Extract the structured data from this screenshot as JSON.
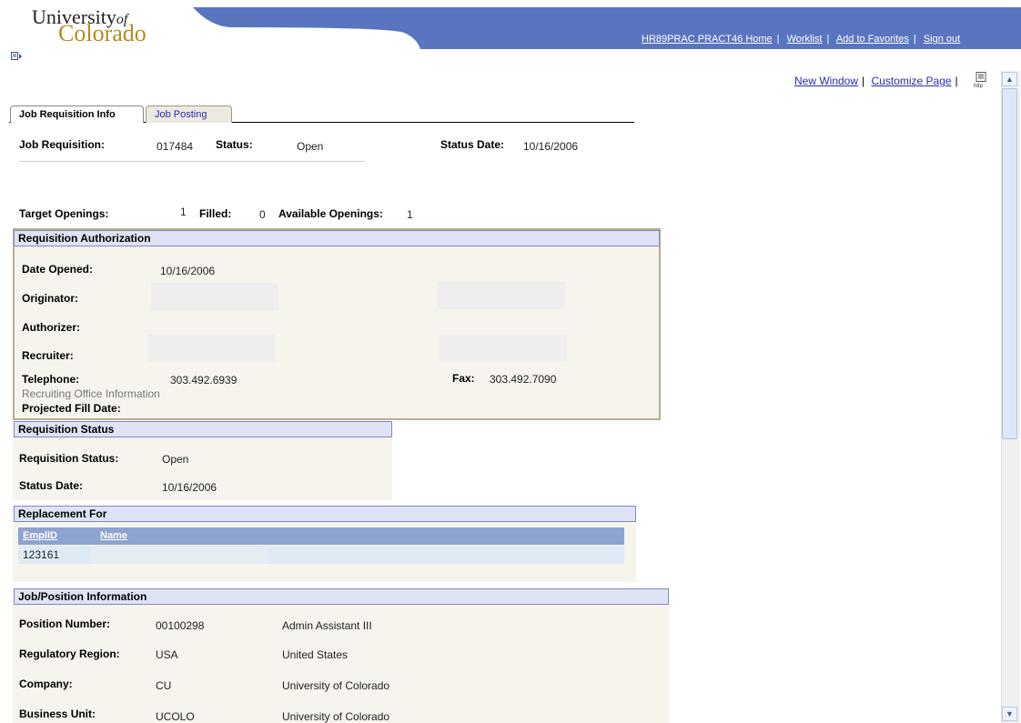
{
  "header": {
    "logo_line1": "University",
    "logo_of": "of",
    "logo_line2": "Colorado",
    "links": [
      "HR89PRAC PRACT46 Home",
      "Worklist",
      "Add to Favorites",
      "Sign out"
    ]
  },
  "page_links": {
    "new_window": "New Window",
    "customize_page": "Customize Page"
  },
  "tabs": {
    "active": "Job Requisition Info",
    "inactive": "Job Posting"
  },
  "summary": {
    "job_requisition_label": "Job Requisition:",
    "job_requisition_value": "017484",
    "status_label": "Status:",
    "status_value": "Open",
    "status_date_label": "Status Date:",
    "status_date_value": "10/16/2006"
  },
  "openings": {
    "target_label": "Target Openings:",
    "target_value": "1",
    "filled_label": "Filled:",
    "filled_value": "0",
    "available_label": "Available Openings:",
    "available_value": "1"
  },
  "authorization": {
    "title": "Requisition Authorization",
    "date_opened_label": "Date Opened:",
    "date_opened_value": "10/16/2006",
    "originator_label": "Originator:",
    "authorizer_label": "Authorizer:",
    "recruiter_label": "Recruiter:",
    "telephone_label": "Telephone:",
    "telephone_value": "303.492.6939",
    "fax_label": "Fax:",
    "fax_value": "303.492.7090",
    "office_info": "Recruiting Office Information",
    "projected_fill_label": "Projected Fill Date:"
  },
  "req_status": {
    "title": "Requisition Status",
    "status_label": "Requisition Status:",
    "status_value": "Open",
    "date_label": "Status Date:",
    "date_value": "10/16/2006"
  },
  "replacement": {
    "title": "Replacement For",
    "col_emplid": "EmplID",
    "col_name": "Name",
    "emplid_value": "123161"
  },
  "job_info": {
    "title": "Job/Position Information",
    "rows": [
      {
        "label": "Position Number:",
        "code": "00100298",
        "desc": "Admin Assistant III"
      },
      {
        "label": "Regulatory Region:",
        "code": "USA",
        "desc": "United States"
      },
      {
        "label": "Company:",
        "code": "CU",
        "desc": "University of Colorado"
      },
      {
        "label": "Business Unit:",
        "code": "UCOLO",
        "desc": "University of Colorado"
      }
    ]
  },
  "colors": {
    "banner_blue": "#5a75c0",
    "logo_gold": "#b58c1c",
    "link_blue": "#2a2ab0",
    "group_bg": "#f6f4ec",
    "group_header": "#dfe3f5"
  },
  "icons": [
    "nav-menu-icon",
    "http-icon",
    "scroll-up-icon",
    "scroll-down-icon"
  ]
}
